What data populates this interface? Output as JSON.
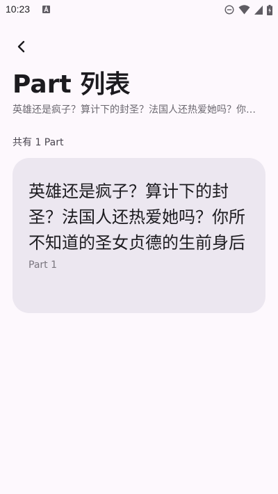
{
  "status_bar": {
    "time": "10:23",
    "icons": [
      "a-notification-icon",
      "do-not-disturb-icon",
      "wifi-icon",
      "cellular-signal-icon",
      "battery-charging-icon"
    ]
  },
  "header": {
    "back_icon": "back-arrow-icon",
    "title": "Part 列表",
    "subtitle": "英雄还是疯子？算计下的封圣？法国人还热爱她吗？你所不知道的圣女贞德的生前身后"
  },
  "list": {
    "count_text": "共有 1 Part",
    "parts": [
      {
        "title": "英雄还是疯子？算计下的封圣？法国人还热爱她吗？你所不知道的圣女贞德的生前身后",
        "label": "Part 1"
      }
    ]
  },
  "colors": {
    "background": "#fdf8fd",
    "card": "#ece7f0",
    "text_primary": "#1c1b1f",
    "text_secondary": "#6b6870"
  }
}
